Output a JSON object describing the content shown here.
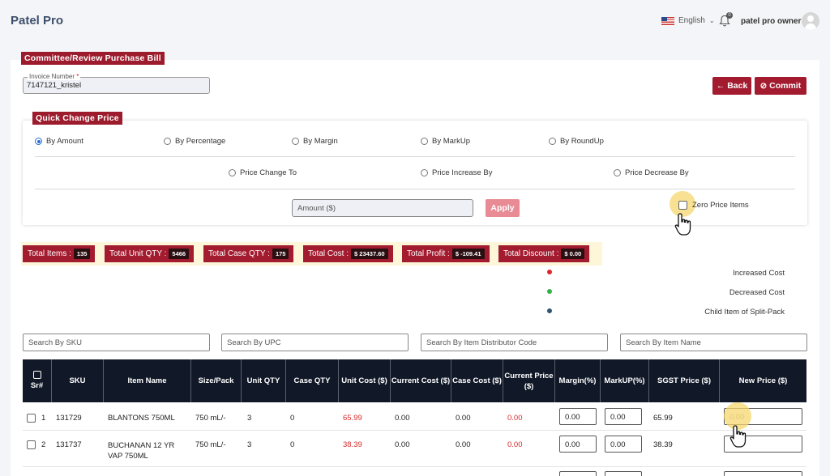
{
  "app": {
    "brand": "Patel Pro"
  },
  "header": {
    "language": "English",
    "user_name": "patel pro owner",
    "notification_count": "0"
  },
  "page": {
    "section_title": "Committee/Review Purchase Bill",
    "invoice": {
      "label": "Invoice Number",
      "required_mark": "*",
      "value": "7147121_kristel"
    },
    "back_label": "Back",
    "commit_label": "Commit"
  },
  "quick_change": {
    "title": "Quick Change Price",
    "mode_options": [
      "By Amount",
      "By Percentage",
      "By Margin",
      "By MarkUp",
      "By RoundUp"
    ],
    "selected_mode": "By Amount",
    "change_options": [
      "Price Change To",
      "Price Increase By",
      "Price Decrease By"
    ],
    "amount_placeholder": "Amount ($)",
    "apply_label": "Apply",
    "zero_price_label": "Zero Price Items"
  },
  "stats": [
    {
      "label": "Total Items :",
      "value": "135"
    },
    {
      "label": "Total Unit QTY :",
      "value": "5466"
    },
    {
      "label": "Total Case QTY :",
      "value": "175"
    },
    {
      "label": "Total Cost :",
      "value": "$ 23437.60"
    },
    {
      "label": "Total Profit :",
      "value": "$ -109.41"
    },
    {
      "label": "Total Discount :",
      "value": "$ 0.00"
    }
  ],
  "legend": [
    {
      "label": "Increased Cost",
      "color": "#e0262b"
    },
    {
      "label": "Decreased Cost",
      "color": "#2fb344"
    },
    {
      "label": "Child Item of Split-Pack",
      "color": "#2e5675"
    }
  ],
  "search": {
    "sku": "Search By SKU",
    "upc": "Search By UPC",
    "distributor": "Search By Item Distributor Code",
    "name": "Search By Item Name"
  },
  "table": {
    "headers": {
      "sr": "Sr#",
      "sku": "SKU",
      "item_name": "Item Name",
      "size": "Size/Pack",
      "unit_qty": "Unit QTY",
      "case_qty": "Case QTY",
      "unit_cost": "Unit Cost ($)",
      "current_cost": "Current Cost ($)",
      "case_cost": "Case Cost ($)",
      "current_price": "Current Price ($)",
      "margin": "Margin(%)",
      "markup": "MarkUP(%)",
      "sgst": "SGST Price ($)",
      "new_price": "New Price ($)"
    },
    "rows": [
      {
        "sr": "1",
        "sku": "131729",
        "name": "BLANTONS 750ML",
        "size": "750 mL/-",
        "unit_qty": "3",
        "case_qty": "0",
        "unit_cost": "65.99",
        "current_cost": "0.00",
        "case_cost": "0.00",
        "current_price": "0.00",
        "margin": "0.00",
        "markup": "0.00",
        "sgst": "65.99",
        "new_price": "0.00"
      },
      {
        "sr": "2",
        "sku": "131737",
        "name": "BUCHANAN 12 YR VAP 750ML",
        "size": "750 mL/-",
        "unit_qty": "3",
        "case_qty": "0",
        "unit_cost": "38.39",
        "current_cost": "0.00",
        "case_cost": "0.00",
        "current_price": "0.00",
        "margin": "0.00",
        "markup": "0.00",
        "sgst": "38.39",
        "new_price": ""
      }
    ]
  }
}
